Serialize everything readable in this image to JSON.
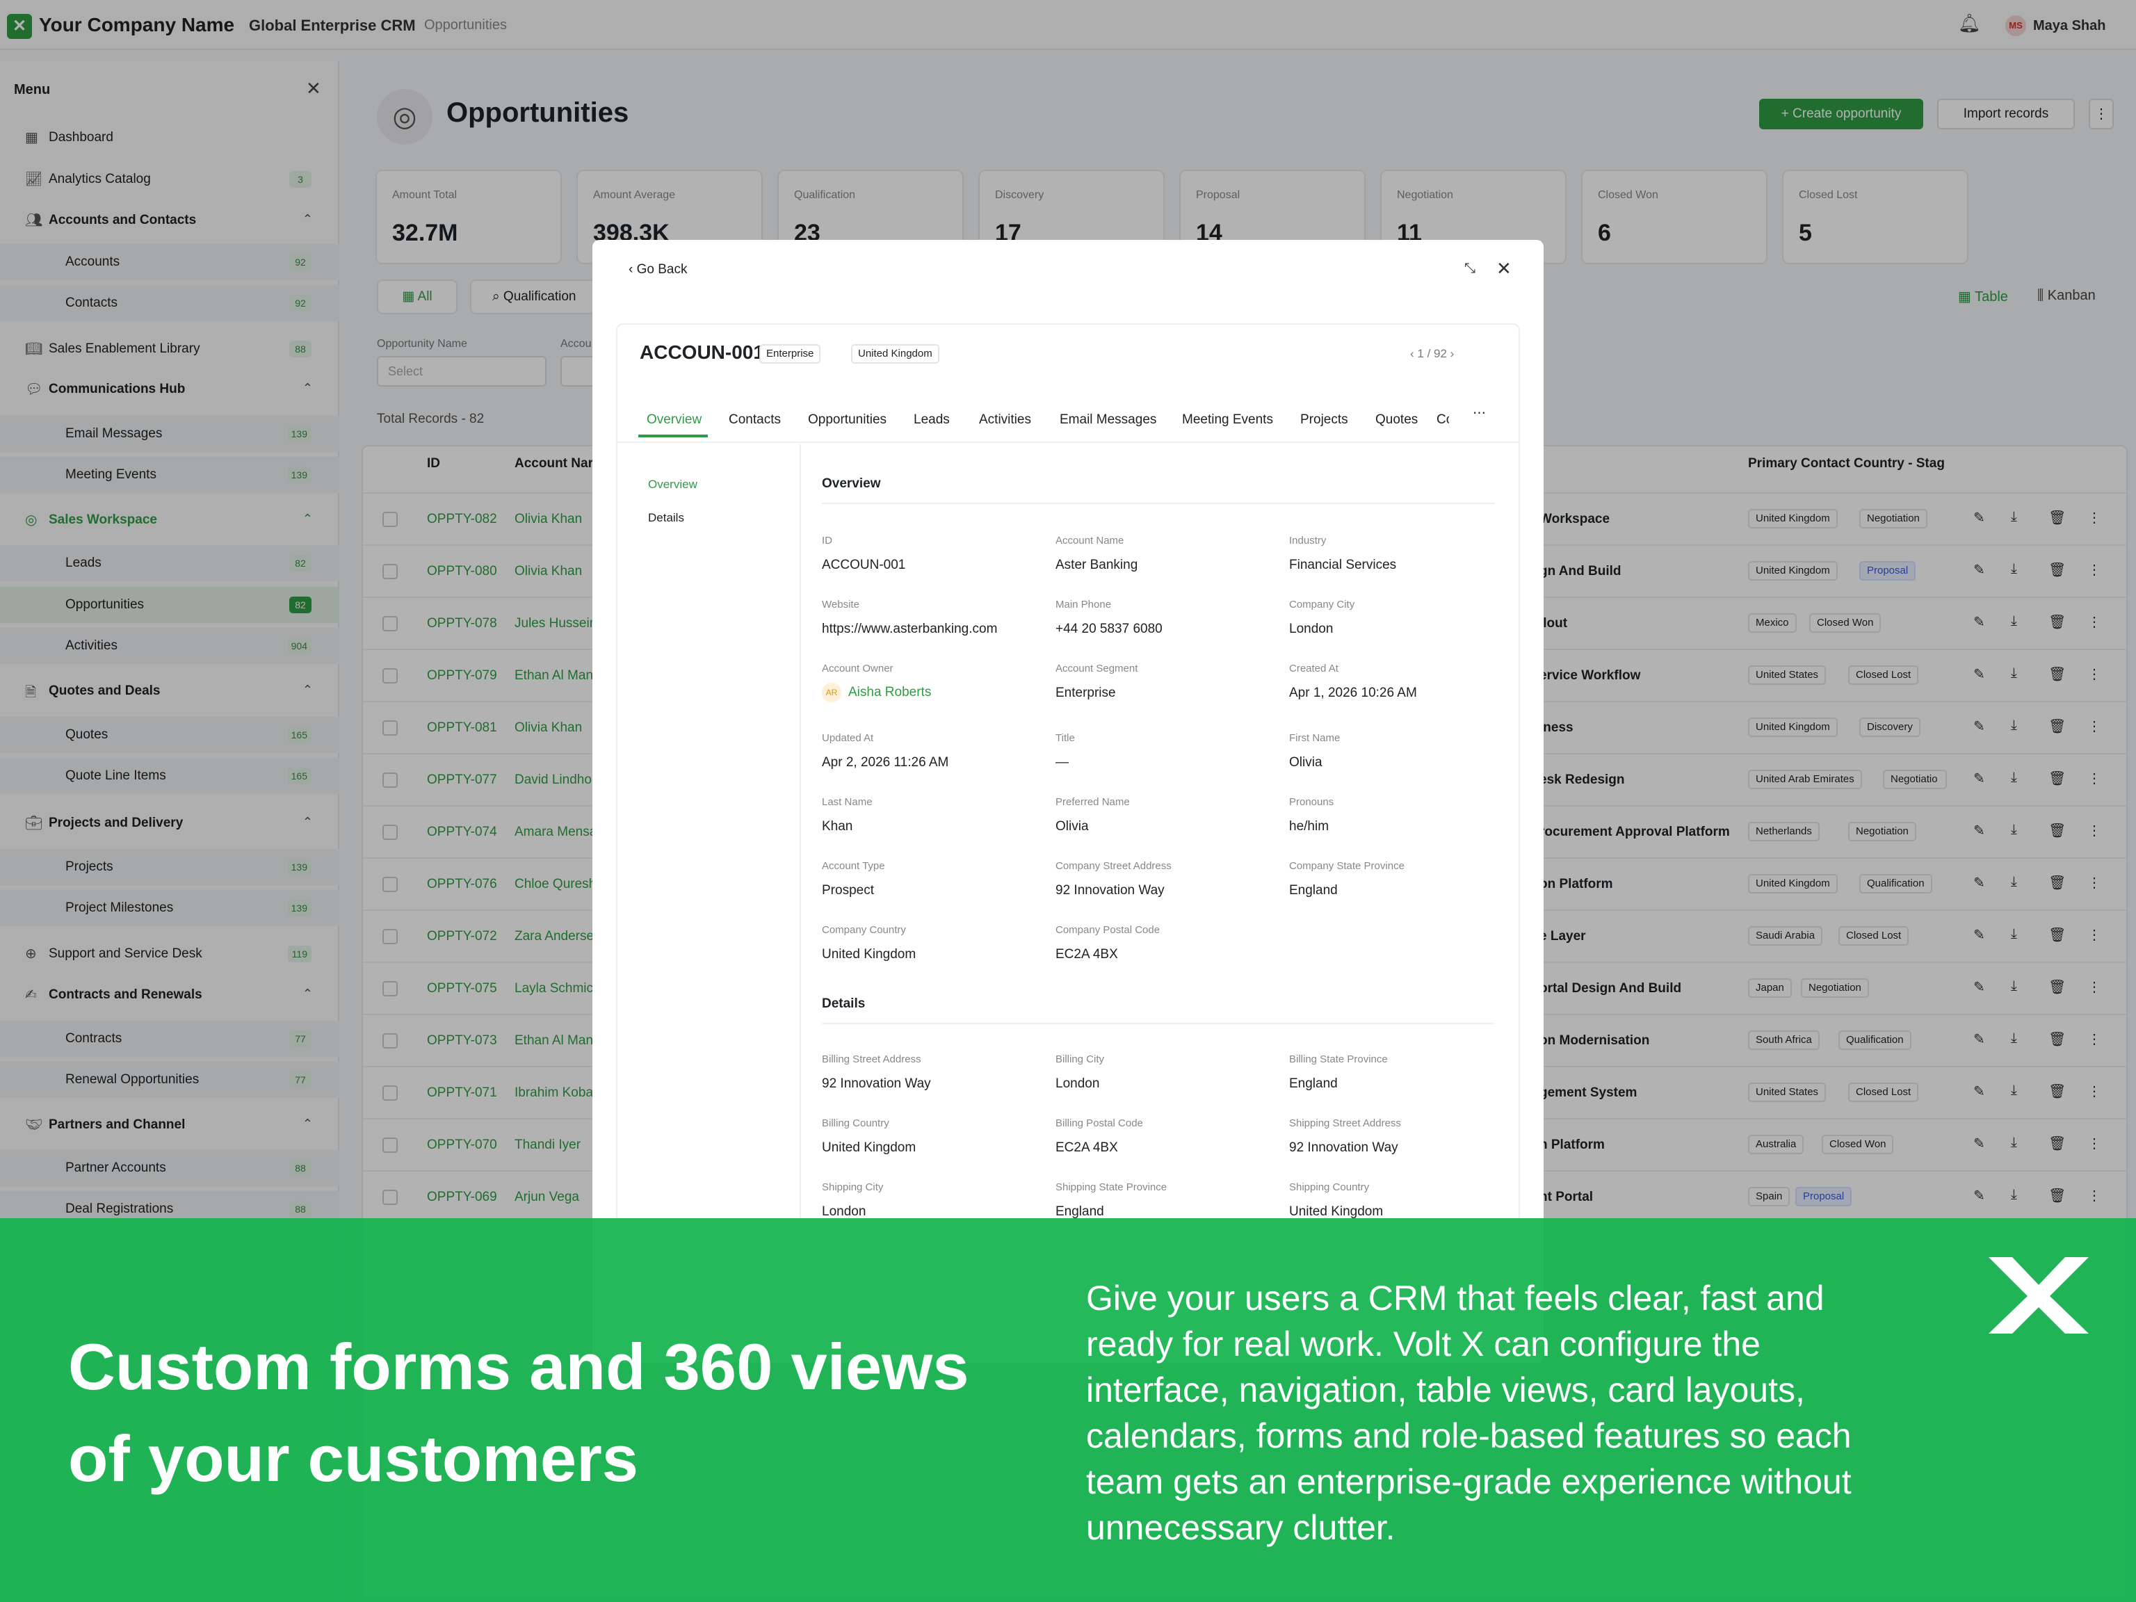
{
  "topbar": {
    "company": "Your Company Name",
    "crm": "Global Enterprise CRM",
    "breadcrumb": "Opportunities",
    "avatar_initials": "MS",
    "user_name": "Maya Shah"
  },
  "sidebar": {
    "title": "Menu",
    "items": [
      {
        "label": "Dashboard",
        "icon": "dashboard-icon"
      },
      {
        "label": "Analytics Catalog",
        "badge": "3",
        "icon": "chart-icon"
      },
      {
        "label": "Accounts and Contacts",
        "icon": "users-icon"
      },
      {
        "label": "Accounts",
        "badge": "92"
      },
      {
        "label": "Contacts",
        "badge": "92"
      },
      {
        "label": "Sales Enablement Library",
        "badge": "88",
        "icon": "book-icon"
      },
      {
        "label": "Communications Hub",
        "icon": "chat-icon"
      },
      {
        "label": "Email Messages",
        "badge": "139"
      },
      {
        "label": "Meeting Events",
        "badge": "139"
      },
      {
        "label": "Sales Workspace",
        "icon": "target-icon"
      },
      {
        "label": "Leads",
        "badge": "82"
      },
      {
        "label": "Opportunities",
        "badge": "82"
      },
      {
        "label": "Activities",
        "badge": "904"
      },
      {
        "label": "Quotes and Deals",
        "icon": "document-icon"
      },
      {
        "label": "Quotes",
        "badge": "165"
      },
      {
        "label": "Quote Line Items",
        "badge": "165"
      },
      {
        "label": "Projects and Delivery",
        "icon": "briefcase-icon"
      },
      {
        "label": "Projects",
        "badge": "139"
      },
      {
        "label": "Project Milestones",
        "badge": "139"
      },
      {
        "label": "Support and Service Desk",
        "badge": "119",
        "icon": "support-icon"
      },
      {
        "label": "Contracts and Renewals",
        "icon": "contract-icon"
      },
      {
        "label": "Contracts",
        "badge": "77"
      },
      {
        "label": "Renewal Opportunities",
        "badge": "77"
      },
      {
        "label": "Partners and Channel",
        "icon": "handshake-icon"
      },
      {
        "label": "Partner Accounts",
        "badge": "88"
      },
      {
        "label": "Deal Registrations",
        "badge": "88"
      }
    ]
  },
  "page": {
    "title": "Opportunities",
    "create_label": "+ Create opportunity",
    "import_label": "Import records",
    "stats": [
      {
        "label": "Amount Total",
        "value": "32.7M"
      },
      {
        "label": "Amount Average",
        "value": "398.3K"
      },
      {
        "label": "Qualification",
        "value": "23"
      },
      {
        "label": "Discovery",
        "value": "17"
      },
      {
        "label": "Proposal",
        "value": "14"
      },
      {
        "label": "Negotiation",
        "value": "11"
      },
      {
        "label": "Closed Won",
        "value": "6"
      },
      {
        "label": "Closed Lost",
        "value": "5"
      }
    ],
    "tab_all": "All",
    "tab_qualification": "Qualification",
    "view_table": "Table",
    "view_kanban": "Kanban",
    "filter_label": "Opportunity Name",
    "filter_label2": "Accou",
    "filter_placeholder": "Select",
    "total_records": "Total Records - 82",
    "columns": {
      "id": "ID",
      "name": "Account Nar",
      "country": "Primary Contact Country - Stag"
    },
    "rows": [
      {
        "id": "OPPTY-082",
        "name": "Olivia Khan",
        "opp": "Workspace",
        "country": "United Kingdom",
        "stage": "Negotiation"
      },
      {
        "id": "OPPTY-080",
        "name": "Olivia Khan",
        "opp": "gn And Build",
        "country": "United Kingdom",
        "stage": "Proposal"
      },
      {
        "id": "OPPTY-078",
        "name": "Jules Hussein",
        "opp": "llout",
        "country": "Mexico",
        "stage": "Closed Won"
      },
      {
        "id": "OPPTY-079",
        "name": "Ethan Al Man",
        "opp": "ervice Workflow",
        "country": "United States",
        "stage": "Closed Lost"
      },
      {
        "id": "OPPTY-081",
        "name": "Olivia Khan",
        "opp": "iness",
        "country": "United Kingdom",
        "stage": "Discovery"
      },
      {
        "id": "OPPTY-077",
        "name": "David Lindho",
        "opp": "esk Redesign",
        "country": "United Arab Emirates",
        "stage": "Negotiatio"
      },
      {
        "id": "OPPTY-074",
        "name": "Amara Mensa",
        "opp": "rocurement Approval Platform",
        "country": "Netherlands",
        "stage": "Negotiation"
      },
      {
        "id": "OPPTY-076",
        "name": "Chloe Quresh",
        "opp": "on Platform",
        "country": "United Kingdom",
        "stage": "Qualification"
      },
      {
        "id": "OPPTY-072",
        "name": "Zara Anderse",
        "opp": "e Layer",
        "country": "Saudi Arabia",
        "stage": "Closed Lost"
      },
      {
        "id": "OPPTY-075",
        "name": "Layla Schmic",
        "opp": "ortal Design And Build",
        "country": "Japan",
        "stage": "Negotiation"
      },
      {
        "id": "OPPTY-073",
        "name": "Ethan Al Man",
        "opp": "on Modernisation",
        "country": "South Africa",
        "stage": "Qualification"
      },
      {
        "id": "OPPTY-071",
        "name": "Ibrahim Koba",
        "opp": "gement System",
        "country": "United States",
        "stage": "Closed Lost"
      },
      {
        "id": "OPPTY-070",
        "name": "Thandi Iyer",
        "opp": "n Platform",
        "country": "Australia",
        "stage": "Closed Won"
      },
      {
        "id": "OPPTY-069",
        "name": "Arjun Vega",
        "opp": "nt Portal",
        "country": "Spain",
        "stage": "Proposal"
      }
    ]
  },
  "modal": {
    "go_back": "Go Back",
    "account_id": "ACCOUN-001",
    "chip1": "Enterprise",
    "chip2": "United Kingdom",
    "pager": "1 / 92",
    "tabs": [
      "Overview",
      "Contacts",
      "Opportunities",
      "Leads",
      "Activities",
      "Email Messages",
      "Meeting Events",
      "Projects",
      "Quotes",
      "Co"
    ],
    "left_nav": [
      "Overview",
      "Details"
    ],
    "overview_title": "Overview",
    "details_title": "Details",
    "overview_fields": [
      {
        "label": "ID",
        "value": "ACCOUN-001"
      },
      {
        "label": "Account Name",
        "value": "Aster Banking"
      },
      {
        "label": "Industry",
        "value": "Financial Services"
      },
      {
        "label": "Website",
        "value": "https://www.asterbanking.com"
      },
      {
        "label": "Main Phone",
        "value": "+44 20 5837 6080"
      },
      {
        "label": "Company City",
        "value": "London"
      },
      {
        "label": "Account Owner",
        "value": "Aisha Roberts",
        "initials": "AR"
      },
      {
        "label": "Account Segment",
        "value": "Enterprise"
      },
      {
        "label": "Created At",
        "value": "Apr 1, 2026 10:26 AM"
      },
      {
        "label": "Updated At",
        "value": "Apr 2, 2026 11:26 AM"
      },
      {
        "label": "Title",
        "value": "—"
      },
      {
        "label": "First Name",
        "value": "Olivia"
      },
      {
        "label": "Last Name",
        "value": "Khan"
      },
      {
        "label": "Preferred Name",
        "value": "Olivia"
      },
      {
        "label": "Pronouns",
        "value": "he/him"
      },
      {
        "label": "Account Type",
        "value": "Prospect"
      },
      {
        "label": "Company Street Address",
        "value": "92 Innovation Way"
      },
      {
        "label": "Company State Province",
        "value": "England"
      },
      {
        "label": "Company Country",
        "value": "United Kingdom"
      },
      {
        "label": "Company Postal Code",
        "value": "EC2A 4BX"
      }
    ],
    "details_fields": [
      {
        "label": "Billing Street Address",
        "value": "92 Innovation Way"
      },
      {
        "label": "Billing City",
        "value": "London"
      },
      {
        "label": "Billing State Province",
        "value": "England"
      },
      {
        "label": "Billing Country",
        "value": "United Kingdom"
      },
      {
        "label": "Billing Postal Code",
        "value": "EC2A 4BX"
      },
      {
        "label": "Shipping Street Address",
        "value": "92 Innovation Way"
      },
      {
        "label": "Shipping City",
        "value": "London"
      },
      {
        "label": "Shipping State Province",
        "value": "England"
      },
      {
        "label": "Shipping Country",
        "value": "United Kingdom"
      }
    ]
  },
  "banner": {
    "headline_1": "Custom forms and 360 views",
    "headline_2": "of your customers",
    "body": "Give your users a CRM that feels clear, fast and ready for real work. Volt X can configure the interface, navigation, table views, card layouts, calendars, forms and role-based features so each team gets an enterprise-grade experience without unnecessary clutter.",
    "accent": "#14b450"
  }
}
